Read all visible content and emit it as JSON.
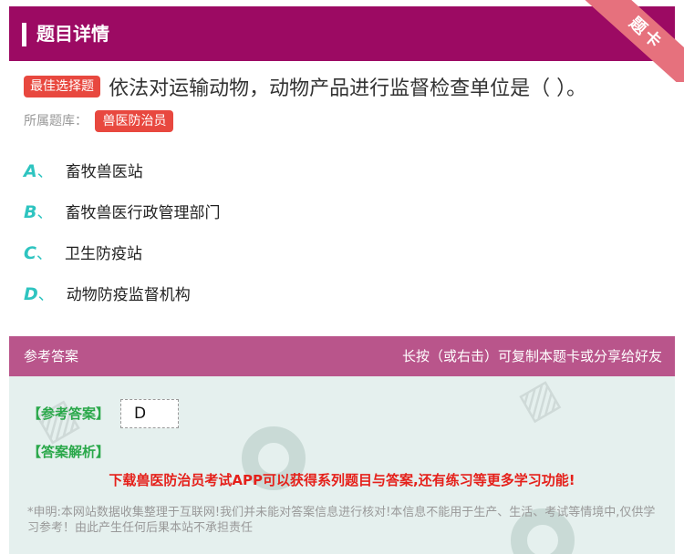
{
  "header": {
    "title": "题目详情"
  },
  "ribbon": {
    "label": "题卡"
  },
  "question": {
    "tag": "最佳选择题",
    "text": "依法对运输动物，动物产品进行监督检查单位是（ ）。"
  },
  "bank": {
    "label": "所属题库：",
    "value": "兽医防治员"
  },
  "options": [
    {
      "letter": "A",
      "sep": "、",
      "text": "畜牧兽医站"
    },
    {
      "letter": "B",
      "sep": "、",
      "text": "畜牧兽医行政管理部门"
    },
    {
      "letter": "C",
      "sep": "、",
      "text": "卫生防疫站"
    },
    {
      "letter": "D",
      "sep": "、",
      "text": "动物防疫监督机构"
    }
  ],
  "answer_bar": {
    "left": "参考答案",
    "right": "长按（或右击）可复制本题卡或分享给好友"
  },
  "answer": {
    "ref_label": "【参考答案】",
    "ref_value": "D",
    "analysis_label": "【答案解析】",
    "promo": "下载兽医防治员考试APP可以获得系列题目与答案,还有练习等更多学习功能!",
    "disclaimer": "*申明:本网站数据收集整理于互联网!我们并未能对答案信息进行核对!本信息不能用于生产、生活、考试等情境中,仅供学习参考！由此产生任何后果本站不承担责任"
  },
  "colors": {
    "header_bg": "#9c0a63",
    "tag_red": "#e8483f",
    "option_letter": "#2ec4c0",
    "answer_bar": "#b9558b",
    "answer_bg": "#e5f0ee",
    "answer_label": "#2aa84a",
    "promo_red": "#e5201a"
  }
}
